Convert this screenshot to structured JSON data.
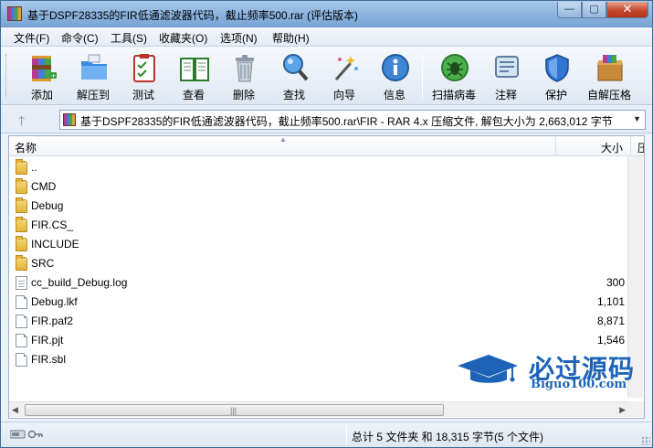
{
  "window": {
    "title": "基于DSPF28335的FIR低通滤波器代码，截止频率500.rar (评估版本)",
    "controls": {
      "minimize": "—",
      "maximize": "▢",
      "close": "✕"
    }
  },
  "menu": [
    {
      "label": "文件(F)"
    },
    {
      "label": "命令(C)"
    },
    {
      "label": "工具(S)"
    },
    {
      "label": "收藏夹(O)"
    },
    {
      "label": "选项(N)"
    },
    {
      "label": "帮助(H)"
    }
  ],
  "toolbar": [
    {
      "label": "添加",
      "icon": "add-archive-icon"
    },
    {
      "label": "解压到",
      "icon": "extract-to-icon"
    },
    {
      "label": "测试",
      "icon": "test-icon"
    },
    {
      "label": "查看",
      "icon": "view-icon"
    },
    {
      "label": "删除",
      "icon": "delete-icon"
    },
    {
      "label": "查找",
      "icon": "find-icon"
    },
    {
      "label": "向导",
      "icon": "wizard-icon"
    },
    {
      "label": "信息",
      "icon": "info-icon"
    },
    {
      "label": "扫描病毒",
      "icon": "virus-scan-icon"
    },
    {
      "label": "注释",
      "icon": "comment-icon"
    },
    {
      "label": "保护",
      "icon": "protect-icon"
    },
    {
      "label": "自解压格",
      "icon": "sfx-icon"
    }
  ],
  "address": {
    "path": "基于DSPF28335的FIR低通滤波器代码，截止频率500.rar\\FIR - RAR 4.x 压缩文件, 解包大小为 2,663,012 字节"
  },
  "columns": {
    "name": "名称",
    "size": "大小",
    "more": "压"
  },
  "files": [
    {
      "name": "..",
      "size": "",
      "type": "folder"
    },
    {
      "name": "CMD",
      "size": "",
      "type": "folder"
    },
    {
      "name": "Debug",
      "size": "",
      "type": "folder"
    },
    {
      "name": "FIR.CS_",
      "size": "",
      "type": "folder"
    },
    {
      "name": "INCLUDE",
      "size": "",
      "type": "folder"
    },
    {
      "name": "SRC",
      "size": "",
      "type": "folder"
    },
    {
      "name": "cc_build_Debug.log",
      "size": "300",
      "type": "text"
    },
    {
      "name": "Debug.lkf",
      "size": "1,101",
      "type": "file"
    },
    {
      "name": "FIR.paf2",
      "size": "8,871",
      "type": "file"
    },
    {
      "name": "FIR.pjt",
      "size": "1,546",
      "type": "file"
    },
    {
      "name": "FIR.sbl",
      "size": "",
      "type": "file"
    }
  ],
  "watermark": {
    "brand": "必过源码",
    "domain": "Biguo100.com"
  },
  "status": {
    "summary": "总计 5 文件夹 和 18,315 字节(5 个文件)"
  },
  "colors": {
    "title_gradient": "#8ab3de",
    "watermark": "#1d63b7",
    "close_button": "#c5472f"
  }
}
